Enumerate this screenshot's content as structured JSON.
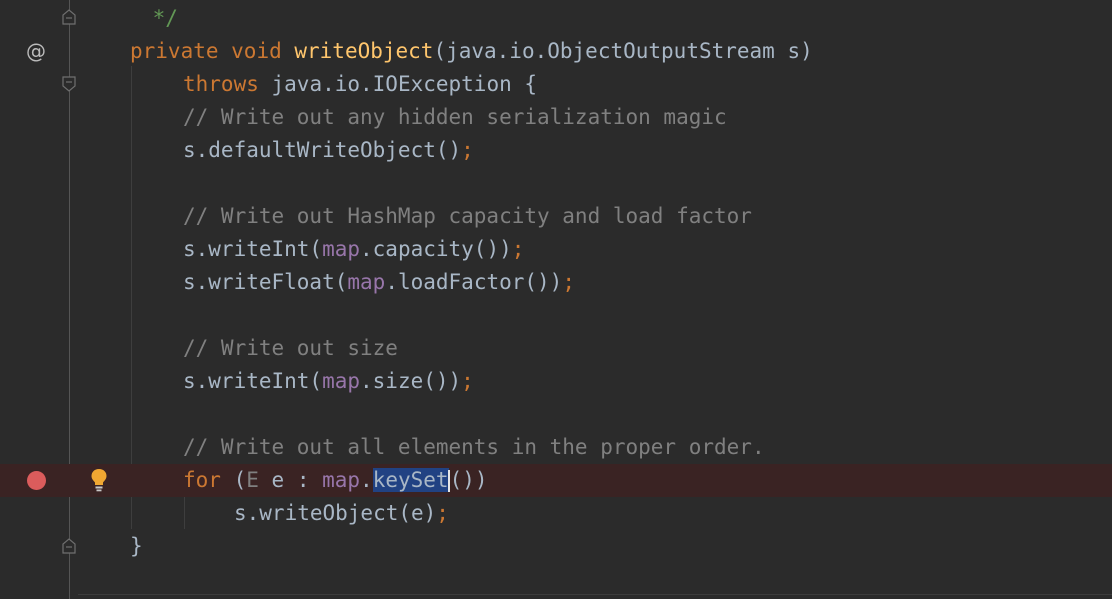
{
  "editor": {
    "gutter": {
      "override_marker": "@",
      "icons": [
        "at-icon",
        "breakpoint-icon",
        "lightbulb-icon",
        "fold-marker-icon"
      ]
    },
    "lines": [
      {
        "tokens": [
          {
            "t": " */",
            "c": "doc"
          }
        ]
      },
      {
        "tokens": [
          {
            "t": "private ",
            "c": "kw"
          },
          {
            "t": "void ",
            "c": "kw"
          },
          {
            "t": "writeObject",
            "c": "fn"
          },
          {
            "t": "(java.io.ObjectOutputStream s)",
            "c": ""
          }
        ]
      },
      {
        "tokens": [
          {
            "t": "throws ",
            "c": "kw"
          },
          {
            "t": "java.io.IOException {",
            "c": ""
          }
        ]
      },
      {
        "tokens": [
          {
            "t": "// Write out any hidden serialization magic",
            "c": "cm"
          }
        ]
      },
      {
        "tokens": [
          {
            "t": "s.defaultWriteObject()",
            "c": ""
          },
          {
            "t": ";",
            "c": "kw"
          }
        ]
      },
      {
        "tokens": []
      },
      {
        "tokens": [
          {
            "t": "// Write out HashMap capacity and load factor",
            "c": "cm"
          }
        ]
      },
      {
        "tokens": [
          {
            "t": "s.writeInt(",
            "c": ""
          },
          {
            "t": "map",
            "c": "fld"
          },
          {
            "t": ".capacity())",
            "c": ""
          },
          {
            "t": ";",
            "c": "kw"
          }
        ]
      },
      {
        "tokens": [
          {
            "t": "s.writeFloat(",
            "c": ""
          },
          {
            "t": "map",
            "c": "fld"
          },
          {
            "t": ".loadFactor())",
            "c": ""
          },
          {
            "t": ";",
            "c": "kw"
          }
        ]
      },
      {
        "tokens": []
      },
      {
        "tokens": [
          {
            "t": "// Write out size",
            "c": "cm"
          }
        ]
      },
      {
        "tokens": [
          {
            "t": "s.writeInt(",
            "c": ""
          },
          {
            "t": "map",
            "c": "fld"
          },
          {
            "t": ".size())",
            "c": ""
          },
          {
            "t": ";",
            "c": "kw"
          }
        ]
      },
      {
        "tokens": []
      },
      {
        "tokens": [
          {
            "t": "// Write out all elements in the proper order.",
            "c": "cm"
          }
        ]
      },
      {
        "tokens": [
          {
            "t": "for ",
            "c": "kw"
          },
          {
            "t": "(",
            "c": ""
          },
          {
            "t": "E",
            "c": "cm"
          },
          {
            "t": " e : ",
            "c": ""
          },
          {
            "t": "map",
            "c": "fld"
          },
          {
            "t": ".",
            "c": ""
          },
          {
            "t": "keySet",
            "c": "sel"
          },
          {
            "t": "|",
            "c": "caret"
          },
          {
            "t": "())",
            "c": ""
          }
        ]
      },
      {
        "tokens": [
          {
            "t": "s.writeObject(e)",
            "c": ""
          },
          {
            "t": ";",
            "c": "kw"
          }
        ]
      },
      {
        "tokens": [
          {
            "t": "}",
            "c": ""
          }
        ]
      }
    ]
  },
  "colors": {
    "background": "#2b2b2b",
    "keyword": "#cc7832",
    "function": "#ffc66d",
    "comment": "#808080",
    "doc_comment": "#629755",
    "field": "#9876aa",
    "plain": "#a9b7c6",
    "breakpoint": "#db5c5c",
    "breakpoint_line": "#3a2323",
    "selection": "#214283"
  }
}
